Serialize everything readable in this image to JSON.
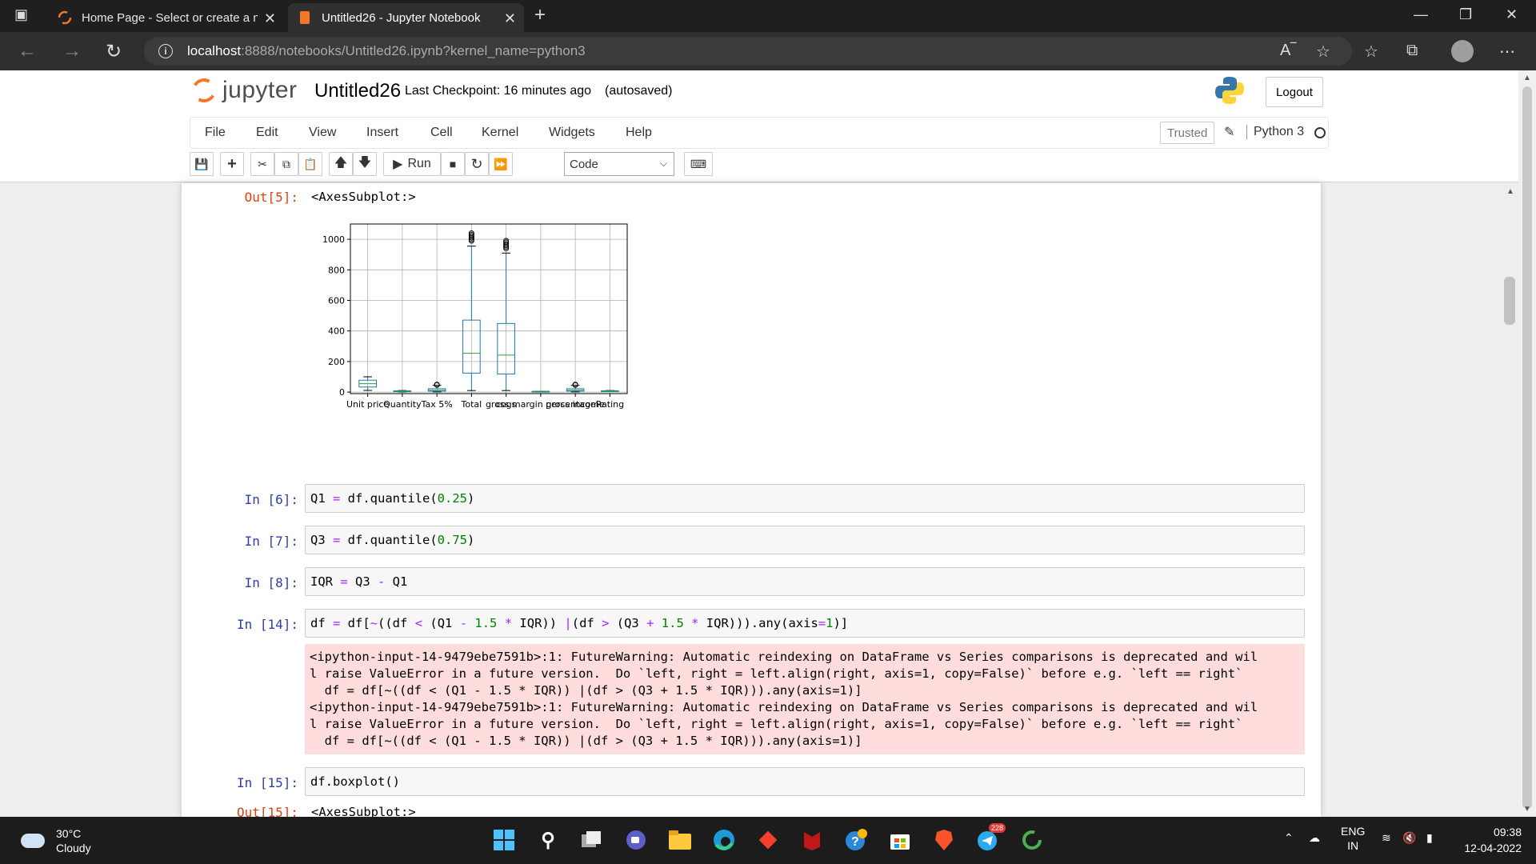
{
  "browser": {
    "tabs": [
      {
        "title": "Home Page - Select or create a n",
        "active": false
      },
      {
        "title": "Untitled26 - Jupyter Notebook",
        "active": true
      }
    ],
    "url_host": "localhost",
    "url_path": ":8888/notebooks/Untitled26.ipynb?kernel_name=python3"
  },
  "jupyter": {
    "logo_text": "jupyter",
    "notebook_name": "Untitled26",
    "checkpoint": "Last Checkpoint: 16 minutes ago",
    "autosaved": "(autosaved)",
    "logout": "Logout",
    "menu": [
      "File",
      "Edit",
      "View",
      "Insert",
      "Cell",
      "Kernel",
      "Widgets",
      "Help"
    ],
    "trusted": "Trusted",
    "kernel": "Python 3",
    "toolbar": {
      "run_label": "Run",
      "cell_type": "Code"
    }
  },
  "cells": {
    "out5_prompt": "Out[5]:",
    "out5_text": "<AxesSubplot:>",
    "in6_prompt": "In [6]:",
    "in7_prompt": "In [7]:",
    "in8_prompt": "In [8]:",
    "in14_prompt": "In [14]:",
    "in15_prompt": "In [15]:",
    "in15_code": "df.boxplot()",
    "out15_prompt": "Out[15]:",
    "out15_text": "<AxesSubplot:>",
    "stderr_lines": [
      "<ipython-input-14-9479ebe7591b>:1: FutureWarning: Automatic reindexing on DataFrame vs Series comparisons is deprecated and wil",
      "l raise ValueError in a future version.  Do `left, right = left.align(right, axis=1, copy=False)` before e.g. `left == right`",
      "  df = df[~((df < (Q1 - 1.5 * IQR)) |(df > (Q3 + 1.5 * IQR))).any(axis=1)]",
      "<ipython-input-14-9479ebe7591b>:1: FutureWarning: Automatic reindexing on DataFrame vs Series comparisons is deprecated and wil",
      "l raise ValueError in a future version.  Do `left, right = left.align(right, axis=1, copy=False)` before e.g. `left == right`",
      "  df = df[~((df < (Q1 - 1.5 * IQR)) |(df > (Q3 + 1.5 * IQR))).any(axis=1)]"
    ]
  },
  "chart_data": {
    "type": "box",
    "categories": [
      "Unit price",
      "Quantity",
      "Tax 5%",
      "Total",
      "gross margin percentage",
      "gross income",
      "cogs",
      "Rating"
    ],
    "tick_labels": [
      "Unit price",
      "Quantity",
      "Tax 5%",
      "Total",
      "cogs",
      "gross margin percentage",
      "gross income",
      "Rating"
    ],
    "yticks": [
      0,
      200,
      400,
      600,
      800,
      1000
    ],
    "ylim": [
      -10,
      1100
    ],
    "grid": true,
    "boxes": [
      {
        "name": "Unit price",
        "whislo": 11,
        "q1": 33,
        "med": 55,
        "q3": 78,
        "whishi": 100,
        "fliers": []
      },
      {
        "name": "Quantity",
        "whislo": 1,
        "q1": 3,
        "med": 5,
        "q3": 8,
        "whishi": 10,
        "fliers": []
      },
      {
        "name": "Tax 5%",
        "whislo": 1,
        "q1": 6,
        "med": 12,
        "q3": 22,
        "whishi": 44,
        "fliers": [
          47,
          48,
          49
        ]
      },
      {
        "name": "Total",
        "whislo": 10,
        "q1": 124,
        "med": 254,
        "q3": 471,
        "whishi": 955,
        "fliers": [
          990,
          1000,
          1010,
          1020,
          1030,
          1040
        ]
      },
      {
        "name": "cogs",
        "whislo": 10,
        "q1": 118,
        "med": 242,
        "q3": 449,
        "whishi": 910,
        "fliers": [
          940,
          950,
          960,
          970,
          980,
          990
        ]
      },
      {
        "name": "gross margin percentage",
        "whislo": 4.76,
        "q1": 4.76,
        "med": 4.76,
        "q3": 4.76,
        "whishi": 4.76,
        "fliers": []
      },
      {
        "name": "gross income",
        "whislo": 1,
        "q1": 6,
        "med": 12,
        "q3": 22,
        "whishi": 44,
        "fliers": [
          47,
          48,
          49
        ]
      },
      {
        "name": "Rating",
        "whislo": 4,
        "q1": 5.5,
        "med": 7,
        "q3": 8.5,
        "whishi": 10,
        "fliers": []
      }
    ],
    "colors": {
      "box": "#1f77b4",
      "median": "#2ca02c"
    }
  },
  "taskbar": {
    "temp": "30°C",
    "condition": "Cloudy",
    "lang1": "ENG",
    "lang2": "IN",
    "time": "09:38",
    "date": "12-04-2022",
    "telegram_badge": "228"
  },
  "colors": {
    "orange": "#f37726",
    "in_prompt": "#303f9f",
    "out_prompt": "#d84315",
    "stderr_bg": "#ffdddd"
  }
}
